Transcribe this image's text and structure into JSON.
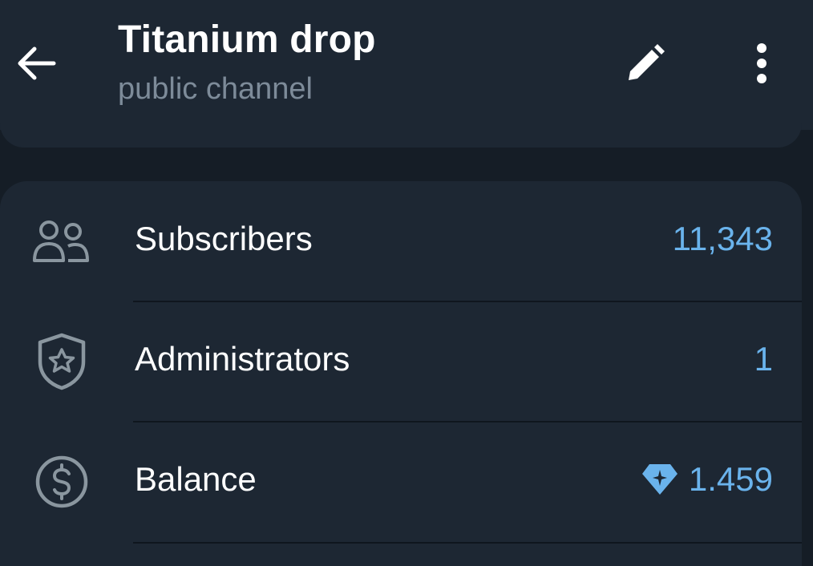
{
  "header": {
    "title": "Titanium drop",
    "subtitle": "public channel",
    "back_icon": "arrow-left-icon",
    "edit_icon": "pencil-icon",
    "menu_icon": "more-vertical-icon"
  },
  "rows": [
    {
      "label": "Subscribers",
      "value": "11,343",
      "icon": "users-icon"
    },
    {
      "label": "Administrators",
      "value": "1",
      "icon": "shield-star-icon"
    },
    {
      "label": "Balance",
      "value": "1.459",
      "icon": "dollar-circle-icon",
      "value_icon": "diamond-icon"
    }
  ],
  "colors": {
    "background": "#151d26",
    "card": "#1d2733",
    "accent": "#6ab3ec",
    "secondary_text": "#7d8b99",
    "icon": "#8a969f"
  }
}
